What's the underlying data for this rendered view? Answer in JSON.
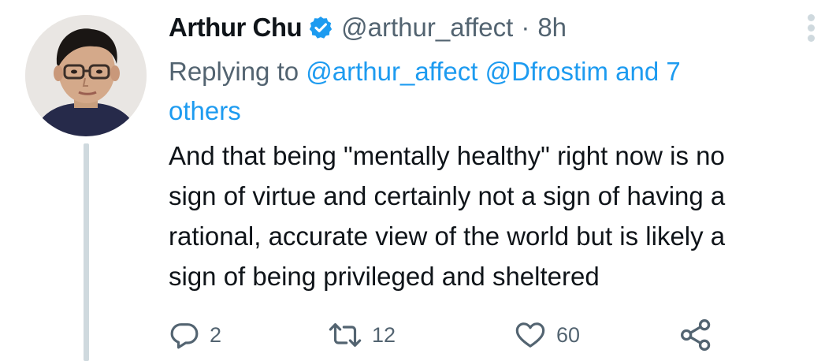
{
  "tweet": {
    "author": {
      "display_name": "Arthur Chu",
      "verified_icon": "verified-badge-icon",
      "handle": "@arthur_affect",
      "separator": "·",
      "time": "8h"
    },
    "replying": {
      "prefix": "Replying to ",
      "mention_1": "@arthur_affect",
      "mention_2": "@Dfrostim",
      "and_others_line1": "and 7",
      "and_others_line2": "others"
    },
    "text_lines": [
      "And that being \"mentally healthy\" right now is no",
      "sign of virtue and certainly not a sign of having a",
      "rational, accurate view of the world but is likely a",
      "sign of being privileged and sheltered"
    ],
    "actions": {
      "reply_count": "2",
      "retweet_count": "12",
      "like_count": "60"
    }
  },
  "colors": {
    "text": "#0f1419",
    "secondary": "#536471",
    "accent": "#1d9bf0",
    "thread_line": "#cfd9de"
  },
  "icons": [
    "verified-badge-icon",
    "more-options-icon",
    "reply-icon",
    "retweet-icon",
    "like-icon",
    "share-icon"
  ]
}
